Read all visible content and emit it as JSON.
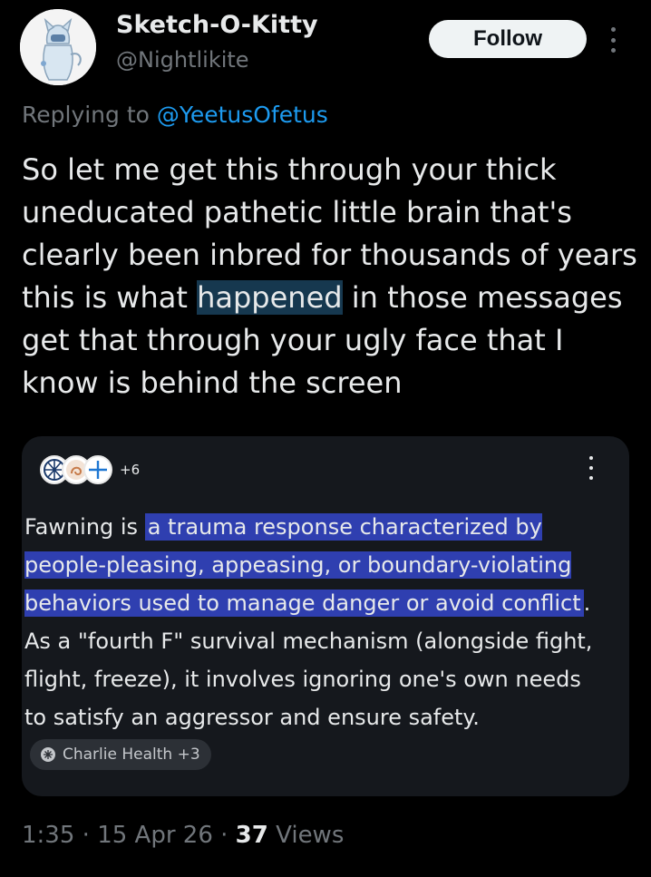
{
  "author": {
    "name": "Sketch-O-Kitty",
    "handle": "@Nightlikite",
    "avatar_icon": "sketch-kitty-avatar"
  },
  "actions": {
    "follow_label": "Follow",
    "more_icon": "more-vertical-icon"
  },
  "reply": {
    "prefix": "Replying to ",
    "mention": "@YeetusOfetus"
  },
  "tweet": {
    "text_before": "So let me get this through your thick uneducated pathetic little brain that's clearly been inbred for thousands of years this is what ",
    "highlight": "happened",
    "text_after": " in those messages get that through your ugly face that I know is behind the screen"
  },
  "card": {
    "source_count": "+6",
    "intro": "Fawning is ",
    "highlighted_definition": "a trauma response characterized by people-pleasing, appeasing, or boundary-violating behaviors used to manage danger or avoid conflict",
    "rest": ". As a \"fourth F\" survival mechanism (alongside fight, flight, freeze), it involves ignoring one's own needs to satisfy an aggressor and ensure safety.",
    "source_chip": "Charlie Health +3"
  },
  "meta": {
    "time": "1:35",
    "date": "15 Apr 26",
    "views_count": "37",
    "views_label": "Views",
    "separator": " · "
  },
  "colors": {
    "background": "#000000",
    "accent": "#1d9bf0",
    "muted": "#71767b",
    "highlight_definition": "#2f3fb0"
  }
}
